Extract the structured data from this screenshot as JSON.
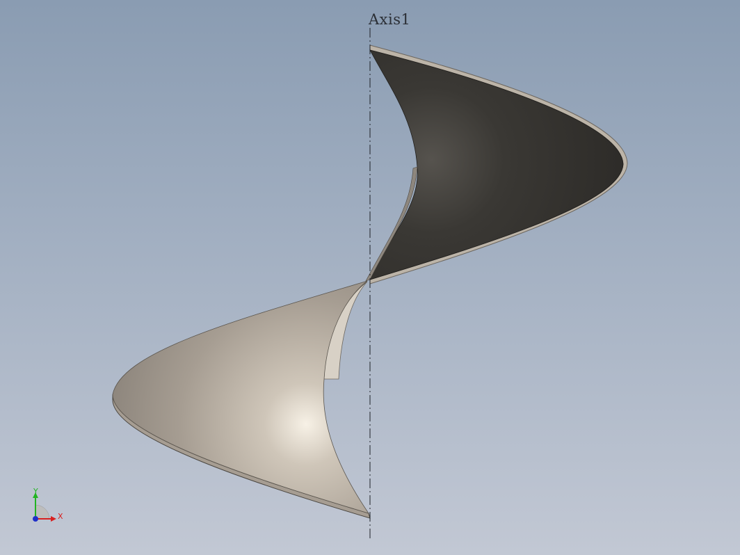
{
  "viewport": {
    "background_top": "#8a9cb2",
    "background_bottom": "#c2c8d4"
  },
  "reference_axis": {
    "label": "Axis1",
    "line_style": "dash-dot",
    "color": "#1e2228"
  },
  "part": {
    "type": "helical sweep surface (half turn)",
    "upper_face_color": "#34322f",
    "lower_face_color": "#ada398",
    "edge_color": "#b8b0a4"
  },
  "triad": {
    "x_label": "X",
    "y_label": "Y",
    "x_color": "#d82020",
    "y_color": "#22b422",
    "z_color": "#2030c8"
  }
}
